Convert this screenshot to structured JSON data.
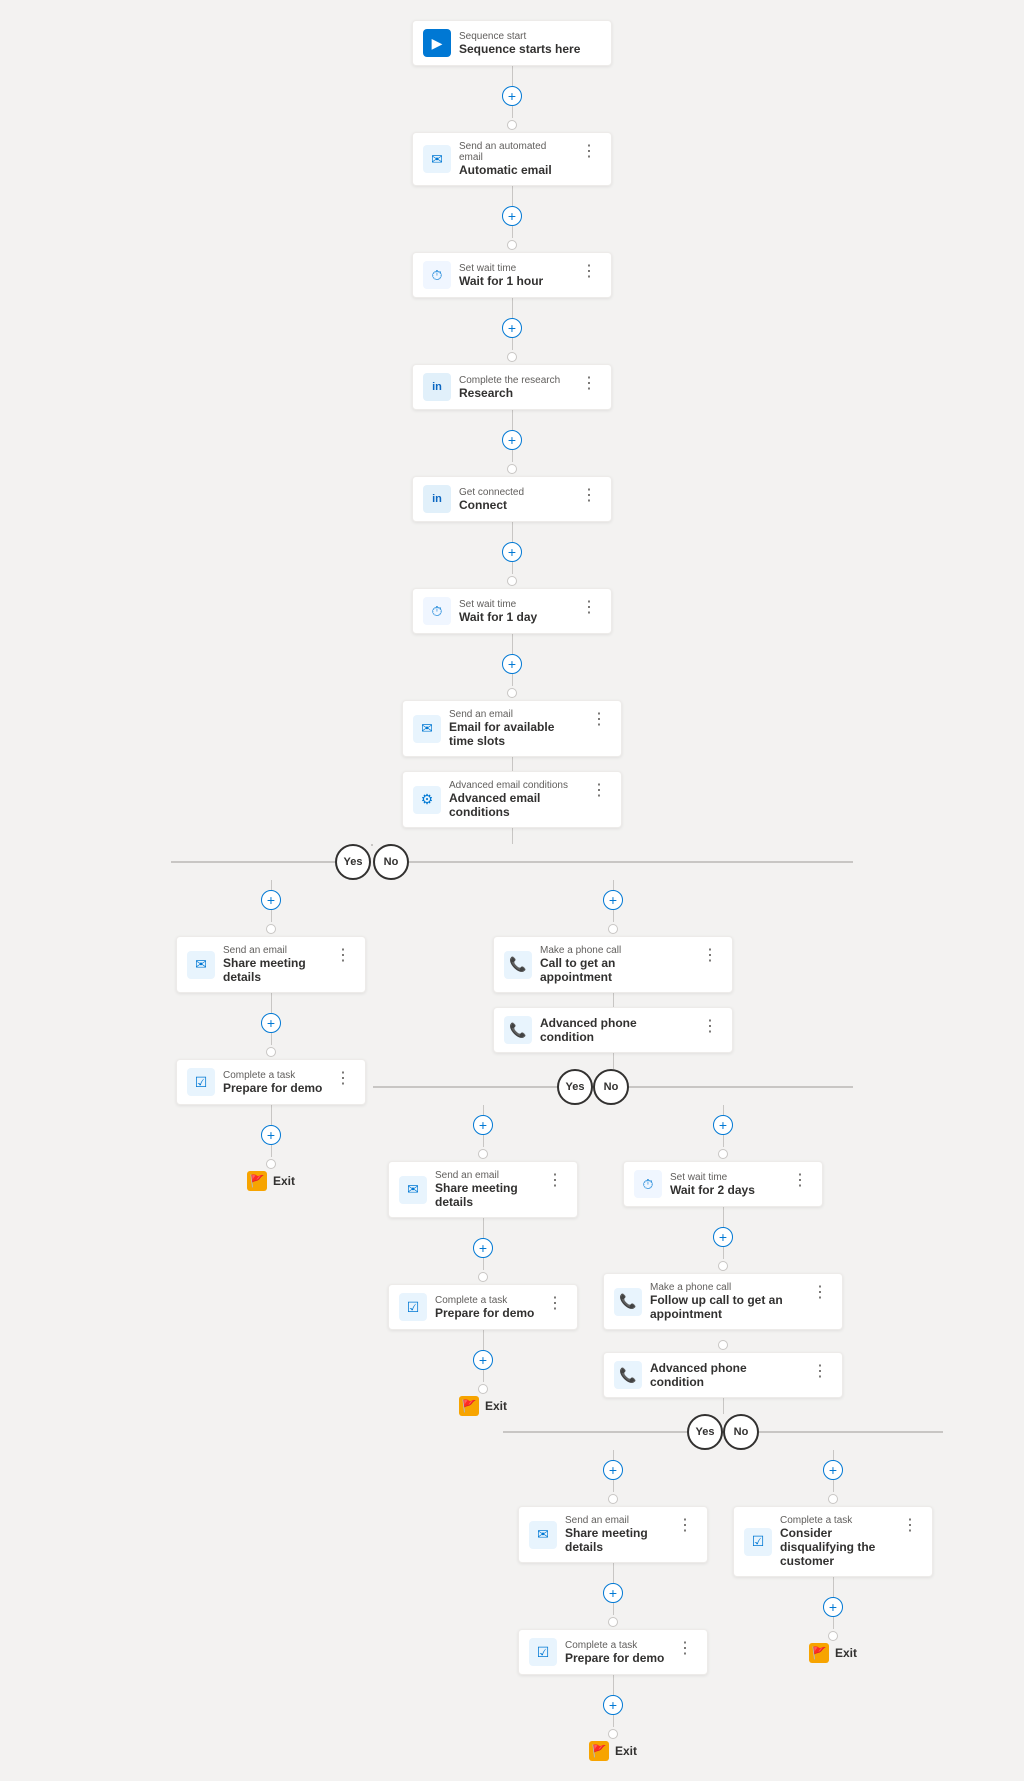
{
  "steps": {
    "sequence_start": {
      "subtitle": "Sequence start",
      "title": "Sequence starts here"
    },
    "automatic_email": {
      "subtitle": "Send an automated email",
      "title": "Automatic email"
    },
    "wait_1hour": {
      "subtitle": "Set wait time",
      "title": "Wait for 1 hour"
    },
    "research": {
      "subtitle": "Complete the research",
      "title": "Research"
    },
    "connect": {
      "subtitle": "Get connected",
      "title": "Connect"
    },
    "wait_1day": {
      "subtitle": "Set wait time",
      "title": "Wait for 1 day"
    },
    "email_timeslots": {
      "subtitle": "Send an email",
      "title": "Email for available time slots"
    },
    "advanced_email": {
      "subtitle": "Advanced email conditions",
      "title": "Advanced email conditions"
    },
    "yes_label": "Yes",
    "no_label": "No",
    "share_meeting_yes_l1": {
      "subtitle": "Send an email",
      "title": "Share meeting details"
    },
    "prepare_demo_yes_l1": {
      "subtitle": "Complete a task",
      "title": "Prepare for demo"
    },
    "exit": "Exit",
    "call_appointment": {
      "subtitle": "Make a phone call",
      "title": "Call to get an appointment"
    },
    "advanced_phone_l1": {
      "subtitle": "",
      "title": "Advanced phone condition"
    },
    "share_meeting_yes_l2": {
      "subtitle": "Send an email",
      "title": "Share meeting details"
    },
    "prepare_demo_yes_l2": {
      "subtitle": "Complete a task",
      "title": "Prepare for demo"
    },
    "wait_2days": {
      "subtitle": "Set wait time",
      "title": "Wait for 2 days"
    },
    "followup_call": {
      "subtitle": "Make a phone call",
      "title": "Follow up call to get an appointment"
    },
    "advanced_phone_l2": {
      "subtitle": "",
      "title": "Advanced phone condition"
    },
    "share_meeting_yes_l3": {
      "subtitle": "Send an email",
      "title": "Share meeting details"
    },
    "prepare_demo_yes_l3": {
      "subtitle": "Complete a task",
      "title": "Prepare for demo"
    },
    "disqualify": {
      "subtitle": "Complete a task",
      "title": "Consider disqualifying the customer"
    }
  },
  "icons": {
    "start": "▶",
    "mail": "✉",
    "wait": "⏱",
    "linkedin": "in",
    "task": "☑",
    "phone": "📞",
    "advanced": "⚙",
    "exit": "🚩",
    "more": "⋮",
    "add": "+",
    "yes": "Yes",
    "no": "No"
  }
}
